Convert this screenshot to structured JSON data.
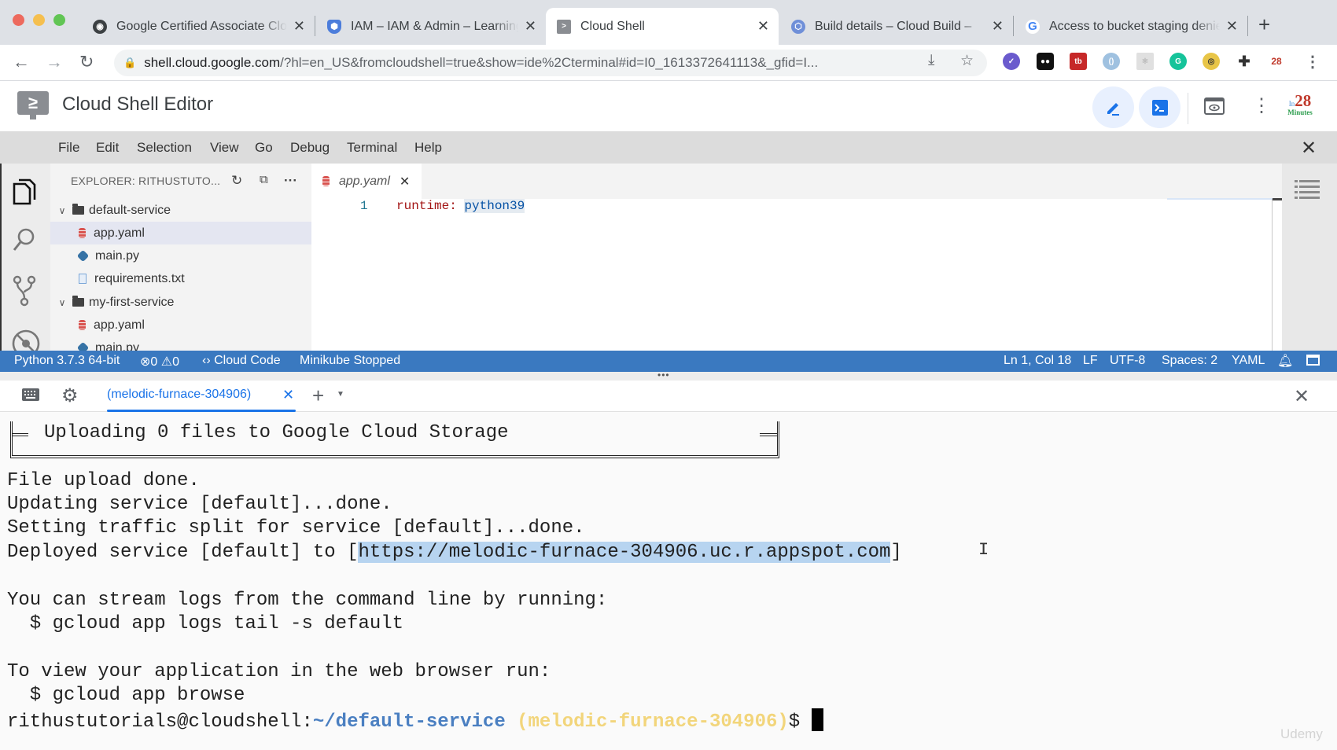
{
  "browser": {
    "tabs": [
      {
        "label": "Google Certified Associate Cloud Engineer",
        "icon": "globe-icon",
        "active": false
      },
      {
        "label": "IAM – IAM & Admin – Learning",
        "icon": "shield-icon",
        "active": false
      },
      {
        "label": "Cloud Shell",
        "icon": "cloud-shell-icon",
        "active": true
      },
      {
        "label": "Build details – Cloud Build – ",
        "icon": "cloud-build-icon",
        "active": false
      },
      {
        "label": "Access to bucket staging denied",
        "icon": "google-icon",
        "active": false
      }
    ],
    "address": {
      "host": "shell.cloud.google.com",
      "path": "/?hl=en_US&fromcloudshell=true&show=ide%2Cterminal#id=I0_1613372641113&_gfid=I..."
    }
  },
  "header": {
    "title": "Cloud Shell Editor",
    "brand": {
      "prefix": "In",
      "number": "28",
      "suffix": "Minutes"
    }
  },
  "menu": [
    "File",
    "Edit",
    "Selection",
    "View",
    "Go",
    "Debug",
    "Terminal",
    "Help"
  ],
  "explorer": {
    "title": "EXPLORER: RITHUSTUTO...",
    "tree": [
      {
        "type": "folder",
        "label": "default-service",
        "expanded": true
      },
      {
        "type": "yaml",
        "label": "app.yaml",
        "selected": true
      },
      {
        "type": "python",
        "label": "main.py"
      },
      {
        "type": "text",
        "label": "requirements.txt"
      },
      {
        "type": "folder",
        "label": "my-first-service",
        "expanded": true
      },
      {
        "type": "yaml",
        "label": "app.yaml"
      },
      {
        "type": "python",
        "label": "main.py"
      }
    ]
  },
  "editor": {
    "tab": {
      "label": "app.yaml"
    },
    "lines": [
      {
        "number": "1",
        "key": "runtime:",
        "value": "python39"
      }
    ]
  },
  "statusbar": {
    "interpreter": "Python 3.7.3 64-bit",
    "errors": "0",
    "warnings": "0",
    "cloud_code": "Cloud Code",
    "minikube": "Minikube Stopped",
    "position": "Ln 1, Col 18",
    "eol": "LF",
    "encoding": "UTF-8",
    "indent": "Spaces: 2",
    "language": "YAML"
  },
  "terminal": {
    "tab_label": "(melodic-furnace-304906)",
    "upload_box": "Uploading 0 files to Google Cloud Storage",
    "lines": [
      "File upload done.",
      "Updating service [default]...done.",
      "Setting traffic split for service [default]...done."
    ],
    "deployed_prefix": "Deployed service [default] to [",
    "deployed_url": "https://melodic-furnace-304906.uc.r.appspot.com",
    "deployed_suffix": "]",
    "logs_hint": "You can stream logs from the command line by running:",
    "logs_cmd": "  $ gcloud app logs tail -s default",
    "browse_hint": "To view your application in the web browser run:",
    "browse_cmd": "  $ gcloud app browse",
    "prompt_user": "rithustutorials@cloudshell:",
    "prompt_path": "~/default-service",
    "prompt_project": "(melodic-furnace-304906)",
    "prompt_symbol": "$"
  },
  "watermark": "Udemy"
}
